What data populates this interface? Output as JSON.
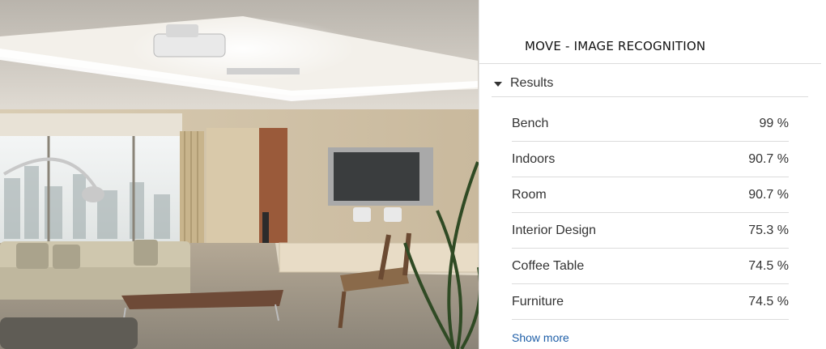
{
  "photo": {
    "alt": "living room"
  },
  "panel": {
    "title": "MOVE - IMAGE RECOGNITION",
    "results_label": "Results",
    "results": [
      {
        "label": "Bench",
        "score": "99 %"
      },
      {
        "label": "Indoors",
        "score": "90.7 %"
      },
      {
        "label": "Room",
        "score": "90.7 %"
      },
      {
        "label": "Interior Design",
        "score": "75.3 %"
      },
      {
        "label": "Coffee Table",
        "score": "74.5 %"
      },
      {
        "label": "Furniture",
        "score": "74.5 %"
      }
    ],
    "show_more_label": "Show more"
  },
  "colors": {
    "link": "#1f5fa8",
    "text": "#333333",
    "divider": "#dcdcdc"
  }
}
